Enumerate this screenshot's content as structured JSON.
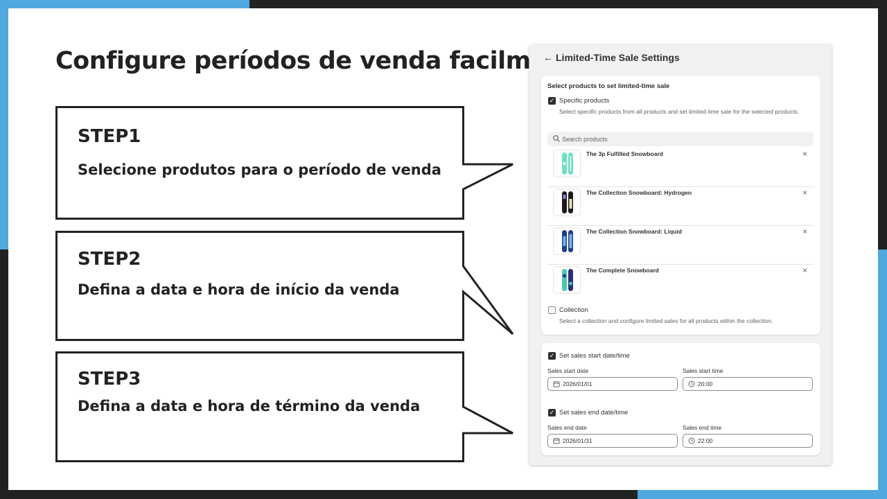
{
  "headline": "Configure períodos de venda facilmente!",
  "steps": [
    {
      "title": "STEP1",
      "description": "Selecione produtos para o período de venda"
    },
    {
      "title": "STEP2",
      "description": "Defina a data e hora de início da venda"
    },
    {
      "title": "STEP3",
      "description": "Defina a data e hora de término da venda"
    }
  ],
  "panel": {
    "back_icon": "arrow-left-icon",
    "title": "Limited-Time Sale Settings",
    "product_card": {
      "title": "Select products to set limited-time sale",
      "specific": {
        "checked": true,
        "label": "Specific products",
        "help": "Select specific products from all products and set limited-time sale for the selected products."
      },
      "search_placeholder": "Search products",
      "products": [
        {
          "name": "The 3p Fulfilled Snowboard",
          "colors": [
            "#6fe0c4",
            "#ffffff"
          ]
        },
        {
          "name": "The Collection Snowboard: Hydrogen",
          "colors": [
            "#1b1b1b",
            "#f2e3c0"
          ]
        },
        {
          "name": "The Collection Snowboard: Liquid",
          "colors": [
            "#1f3f8a",
            "#7ab3e8"
          ]
        },
        {
          "name": "The Complete Snowboard",
          "colors": [
            "#49c7b4",
            "#2a2f7a"
          ]
        }
      ],
      "collection": {
        "checked": false,
        "label": "Collection",
        "help": "Select a collection and configure limited sales for all products within the collection."
      }
    },
    "schedule_card": {
      "start_toggle": {
        "checked": true,
        "label": "Set sales start date/time"
      },
      "start_date_label": "Sales start date",
      "start_date": "2026/01/01",
      "start_time_label": "Sales start time",
      "start_time": "20:00",
      "end_toggle": {
        "checked": true,
        "label": "Set sales end date/time"
      },
      "end_date_label": "Sales end date",
      "end_date": "2026/01/31",
      "end_time_label": "Sales end time",
      "end_time": "22:00"
    }
  },
  "colors": {
    "accent_blue": "#4fa8de",
    "frame_dark": "#222222",
    "panel_bg": "#f1f1f1"
  }
}
